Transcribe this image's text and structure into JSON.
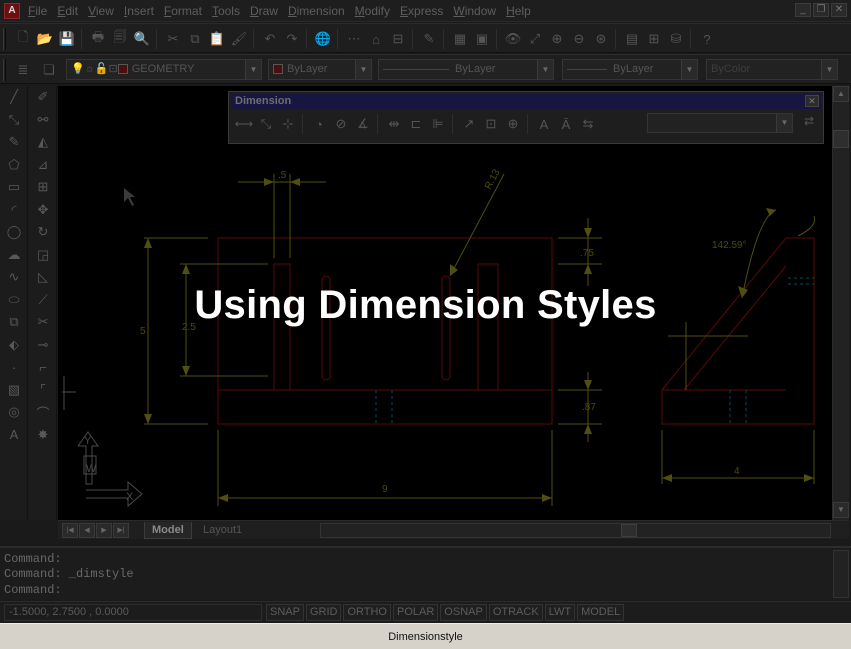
{
  "menubar": {
    "items": [
      "File",
      "Edit",
      "View",
      "Insert",
      "Format",
      "Tools",
      "Draw",
      "Dimension",
      "Modify",
      "Express",
      "Window",
      "Help"
    ]
  },
  "property_toolbar": {
    "layer_combo": "GEOMETRY",
    "color_combo": "ByLayer",
    "linetype_combo": "ByLayer",
    "lineweight_combo": "ByLayer",
    "plotstyle_combo": "ByColor"
  },
  "dimension_toolbar": {
    "title": "Dimension"
  },
  "drawing": {
    "dim_labels": [
      "5",
      ".5",
      "R.13",
      ".75",
      "142.59°",
      "2.5",
      ".87",
      "9",
      "4"
    ],
    "ucs_y": "Y",
    "ucs_w": "W",
    "ucs_x": "X"
  },
  "tabs": {
    "model": "Model",
    "layout1": "Layout1"
  },
  "command": {
    "lines": [
      "Command:",
      "Command: _dimstyle",
      "Command:"
    ]
  },
  "status": {
    "coordinates": "-1.5000, 2.7500 , 0.0000",
    "buttons": [
      "SNAP",
      "GRID",
      "ORTHO",
      "POLAR",
      "OSNAP",
      "OTRACK",
      "LWT",
      "MODEL"
    ]
  },
  "overlay": {
    "title": "Using Dimension Styles"
  },
  "caption": {
    "text": "Dimensionstyle"
  },
  "colors": {
    "geometry_line": "#5a0a0a",
    "dimension_line": "#4f4f10",
    "hidden_line": "#0a4a55"
  }
}
